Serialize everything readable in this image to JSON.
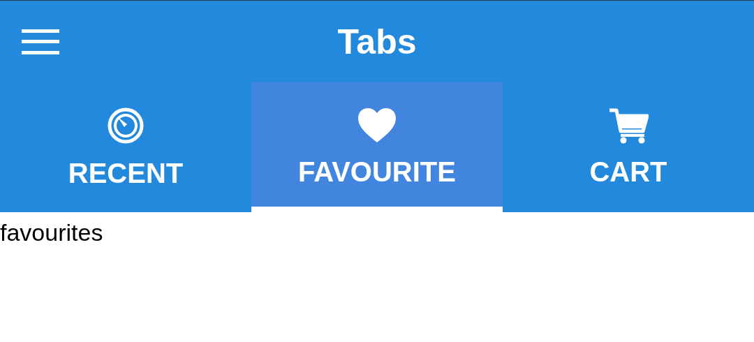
{
  "app_bar": {
    "title": "Tabs"
  },
  "tabs": [
    {
      "label": "RECENT",
      "selected": false
    },
    {
      "label": "FAVOURITE",
      "selected": true
    },
    {
      "label": "CART",
      "selected": false
    }
  ],
  "content": {
    "text": "favourites"
  }
}
